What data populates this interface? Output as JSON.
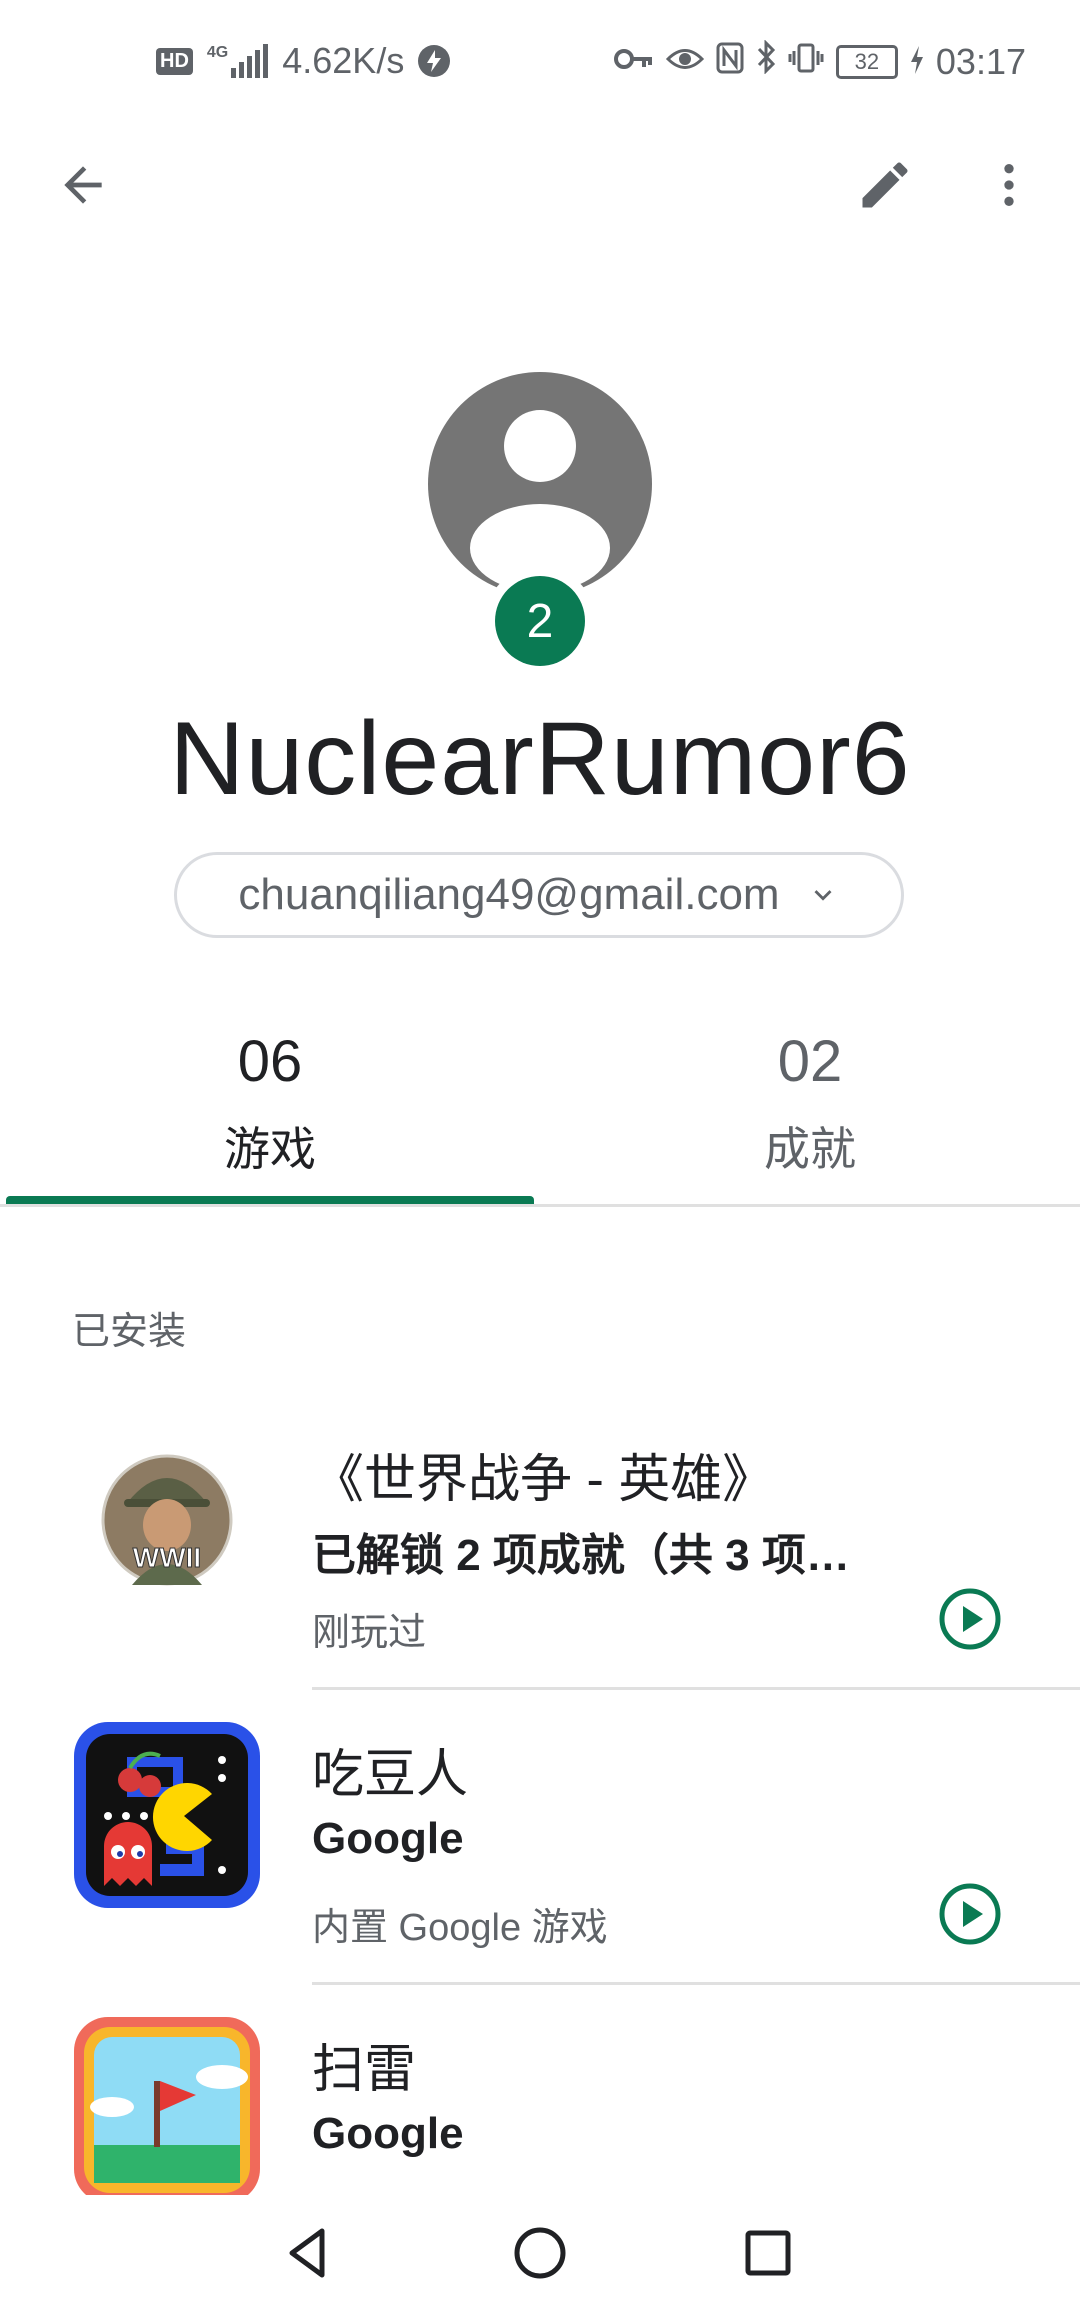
{
  "status_bar": {
    "hd_label": "HD",
    "network": "4G",
    "speed": "4.62K/s",
    "battery": "32",
    "time": "03:17"
  },
  "toolbar": {
    "back_icon": "arrow-back-icon",
    "edit_icon": "pencil-icon",
    "more_icon": "more-vert-icon"
  },
  "profile": {
    "level": "2",
    "player_name": "NuclearRumor6",
    "account_email": "chuanqiliang49@gmail.com"
  },
  "tabs": [
    {
      "count": "06",
      "label": "游戏",
      "selected": true
    },
    {
      "count": "02",
      "label": "成就",
      "selected": false
    }
  ],
  "section": {
    "heading": "已安装"
  },
  "games": [
    {
      "title": "《世界战争 - 英雄》",
      "subtitle": "已解锁 2 项成就（共 3 项…",
      "meta": "刚玩过",
      "icon": "world-war-heroes-icon"
    },
    {
      "title": "吃豆人",
      "subtitle": "Google",
      "meta": "内置 Google 游戏",
      "icon": "pac-man-icon"
    },
    {
      "title": "扫雷",
      "subtitle": "Google",
      "meta": "",
      "icon": "minesweeper-icon"
    }
  ],
  "colors": {
    "accent": "#0a7a53",
    "avatar_bg": "#757575",
    "divider": "#e0e0e0",
    "secondary_text": "#5f6368"
  }
}
